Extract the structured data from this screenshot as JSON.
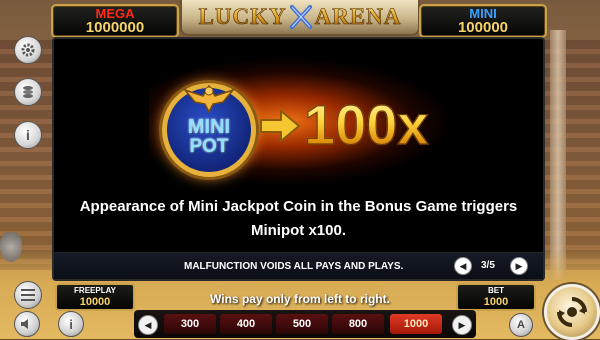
{
  "jackpots": {
    "mega": {
      "label": "MEGA",
      "value": "1000000"
    },
    "mini": {
      "label": "MINI",
      "value": "100000"
    }
  },
  "logo": {
    "left_word": "LUCKY",
    "right_word": "ARENA"
  },
  "side_icons": [
    "gear-icon",
    "coins-icon",
    "info-icon"
  ],
  "info": {
    "coin_line1": "MINI",
    "coin_line2": "POT",
    "multiplier": "100x",
    "description_line1": "Appearance of Mini Jackpot Coin in the Bonus Game triggers",
    "description_line2": "Minipot x100.",
    "notice": "MALFUNCTION VOIDS ALL PAYS AND PLAYS.",
    "page_indicator": "3/5"
  },
  "freeplay": {
    "label": "FREEPLAY",
    "value": "10000"
  },
  "bet": {
    "label": "BET",
    "value": "1000"
  },
  "wins_text": "Wins pay only from left to right.",
  "bet_options": [
    "300",
    "400",
    "500",
    "800",
    "1000"
  ],
  "selected_bet": "1000",
  "auto_label": "A",
  "colors": {
    "mega": "#ff2a1a",
    "mini": "#3aa0ff",
    "gold": "#f5d36a",
    "selected_bet": "#e03a22"
  }
}
